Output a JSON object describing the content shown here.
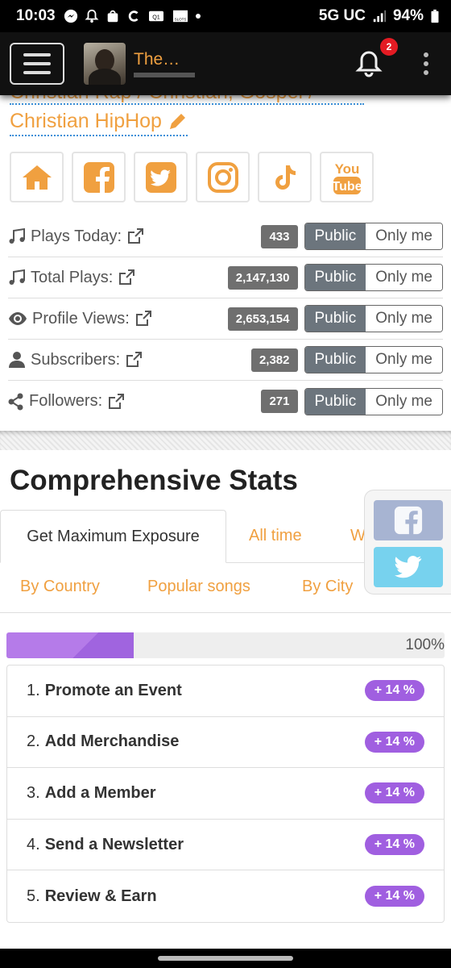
{
  "status": {
    "time": "10:03",
    "network": "5G UC",
    "battery": "94%",
    "slots_label": "SLOTS"
  },
  "header": {
    "title": "The…",
    "notification_count": "2"
  },
  "genre": {
    "top_line": "Christian Rap / Christian, Gospel /",
    "main": "Christian HipHop"
  },
  "socials": [
    "home-icon",
    "facebook-icon",
    "twitter-icon",
    "instagram-icon",
    "tiktok-icon",
    "youtube-icon"
  ],
  "youtube_text": {
    "you": "You",
    "tube": "Tube"
  },
  "stats": [
    {
      "icon": "music-icon",
      "label": "Plays Today:",
      "value": "433",
      "public": "Public",
      "only": "Only me"
    },
    {
      "icon": "music-icon",
      "label": "Total Plays:",
      "value": "2,147,130",
      "public": "Public",
      "only": "Only me"
    },
    {
      "icon": "eye-icon",
      "label": "Profile Views:",
      "value": "2,653,154",
      "public": "Public",
      "only": "Only me"
    },
    {
      "icon": "user-icon",
      "label": "Subscribers:",
      "value": "2,382",
      "public": "Public",
      "only": "Only me"
    },
    {
      "icon": "share-icon",
      "label": "Followers:",
      "value": "271",
      "public": "Public",
      "only": "Only me"
    }
  ],
  "comprehensive": {
    "title": "Comprehensive Stats",
    "tabs_row1": [
      "Get Maximum Exposure",
      "All time",
      "Week"
    ],
    "tabs_row2": [
      "By Country",
      "Popular songs",
      "By City"
    ]
  },
  "progress": {
    "fraction": 0.29,
    "label": "100%"
  },
  "tasks": [
    {
      "num": "1.",
      "title": "Promote an Event",
      "pill": "+ 14 %"
    },
    {
      "num": "2.",
      "title": "Add Merchandise",
      "pill": "+ 14 %"
    },
    {
      "num": "3.",
      "title": "Add a Member",
      "pill": "+ 14 %"
    },
    {
      "num": "4.",
      "title": "Send a Newsletter",
      "pill": "+ 14 %"
    },
    {
      "num": "5.",
      "title": "Review & Earn",
      "pill": "+ 14 %"
    }
  ],
  "colors": {
    "accent": "#f0a040",
    "purple": "#a05fe0",
    "gray_badge": "#6f6f6f"
  }
}
